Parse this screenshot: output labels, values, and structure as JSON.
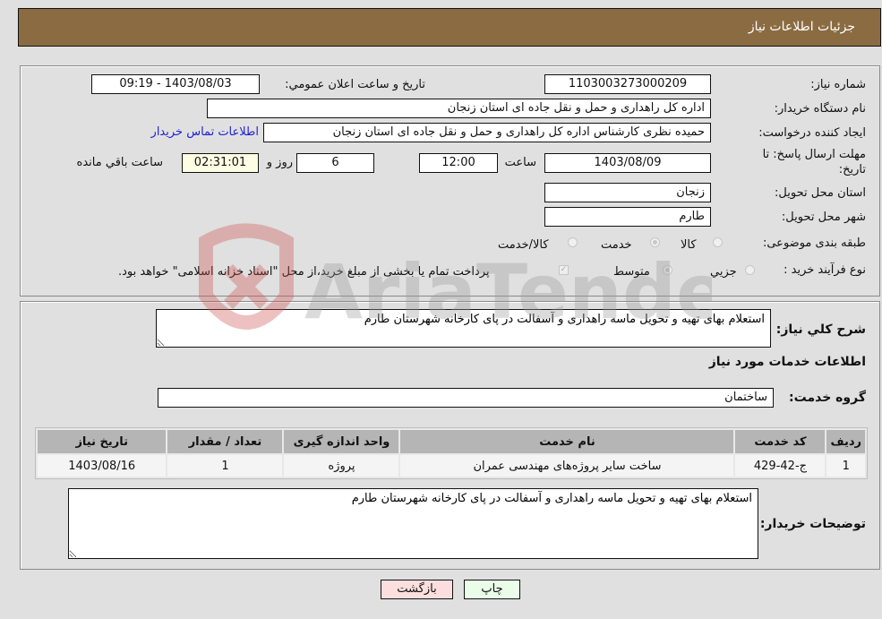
{
  "header": {
    "title": "جزئیات اطلاعات نیاز"
  },
  "form": {
    "need_number": {
      "label": "شماره نیاز:",
      "value": "1103003273000209"
    },
    "announce_datetime": {
      "label": "تاریخ و ساعت اعلان عمومي:",
      "value": "1403/08/03 - 09:19"
    },
    "buyer_org": {
      "label": "نام دستگاه خریدار:",
      "value": "اداره کل راهداری و حمل و نقل جاده ای استان زنجان"
    },
    "requester": {
      "label": "ایجاد کننده درخواست:",
      "value": "حمیده نظری کارشناس اداره کل راهداری و حمل و نقل جاده ای استان زنجان"
    },
    "buyer_contact_link": "اطلاعات تماس خریدار",
    "deadline": {
      "label": "مهلت ارسال پاسخ: تا تاریخ:",
      "date": "1403/08/09",
      "time_label": "ساعت",
      "time": "12:00",
      "days": "6",
      "days_label": "روز و",
      "remaining": "02:31:01",
      "remaining_label": "ساعت باقي مانده"
    },
    "delivery_province": {
      "label": "استان محل تحویل:",
      "value": "زنجان"
    },
    "delivery_city": {
      "label": "شهر محل تحویل:",
      "value": "طارم"
    },
    "category": {
      "label": "طبقه بندی موضوعی:",
      "options": [
        "کالا",
        "خدمت",
        "کالا/خدمت"
      ],
      "selected": "خدمت"
    },
    "purchase_type": {
      "label": "نوع فرآیند خرید :",
      "options": [
        "جزیي",
        "متوسط"
      ],
      "selected": "متوسط",
      "treasury_note": "پرداخت تمام یا بخشی از مبلغ خرید،از محل \"اسناد خزانه اسلامی\" خواهد بود.",
      "treasury_checked": true
    }
  },
  "details": {
    "general_desc_label": "شرح كلي نياز:",
    "general_desc": "استعلام بهای تهیه و تحویل ماسه راهداری و آسفالت در پای کارخانه شهرستان طارم",
    "services_heading": "اطلاعات خدمات مورد نیاز",
    "service_group_label": "گروه خدمت:",
    "service_group": "ساختمان",
    "table": {
      "headers": [
        "ردیف",
        "کد خدمت",
        "نام خدمت",
        "واحد اندازه گیری",
        "تعداد / مقدار",
        "تاریخ نیاز"
      ],
      "rows": [
        [
          "1",
          "ج-42-429",
          "ساخت سایر پروژه‌های مهندسی عمران",
          "پروژه",
          "1",
          "1403/08/16"
        ]
      ]
    },
    "buyer_notes_label": "توضیحات خریدار:",
    "buyer_notes": "استعلام بهای تهیه و تحویل ماسه راهداری و آسفالت در پای کارخانه شهرستان طارم"
  },
  "buttons": {
    "print": "چاپ",
    "back": "بازگشت"
  },
  "colors": {
    "header_bg": "#8b6c42",
    "print_bg": "#e9fde9",
    "back_bg": "#fddede",
    "link": "#1f1fd6"
  },
  "watermark": {
    "text": "AriaTender.neT"
  }
}
